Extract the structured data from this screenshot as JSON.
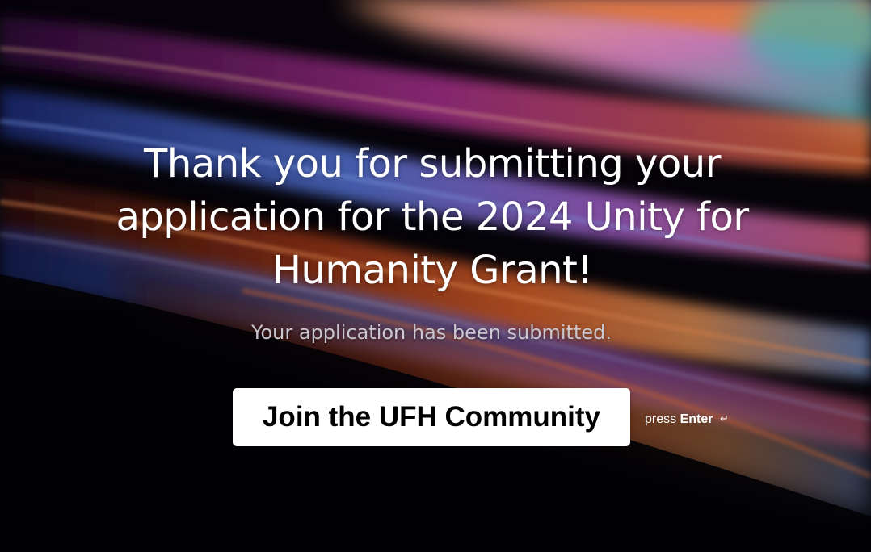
{
  "page": {
    "heading": "Thank you for submitting your application for the 2024 Unity for Humanity Grant!",
    "message": "Your application has been submitted."
  },
  "cta": {
    "button_label": "Join the UFH Community",
    "hint_prefix": "press",
    "hint_key": "Enter",
    "hint_icon": "↵"
  },
  "colors": {
    "background": "#040307",
    "text": "#ffffff",
    "subtext": "#c9c6cf",
    "button_bg": "#ffffff",
    "button_text": "#000000"
  },
  "icons": {
    "enter": "return-arrow-icon"
  }
}
